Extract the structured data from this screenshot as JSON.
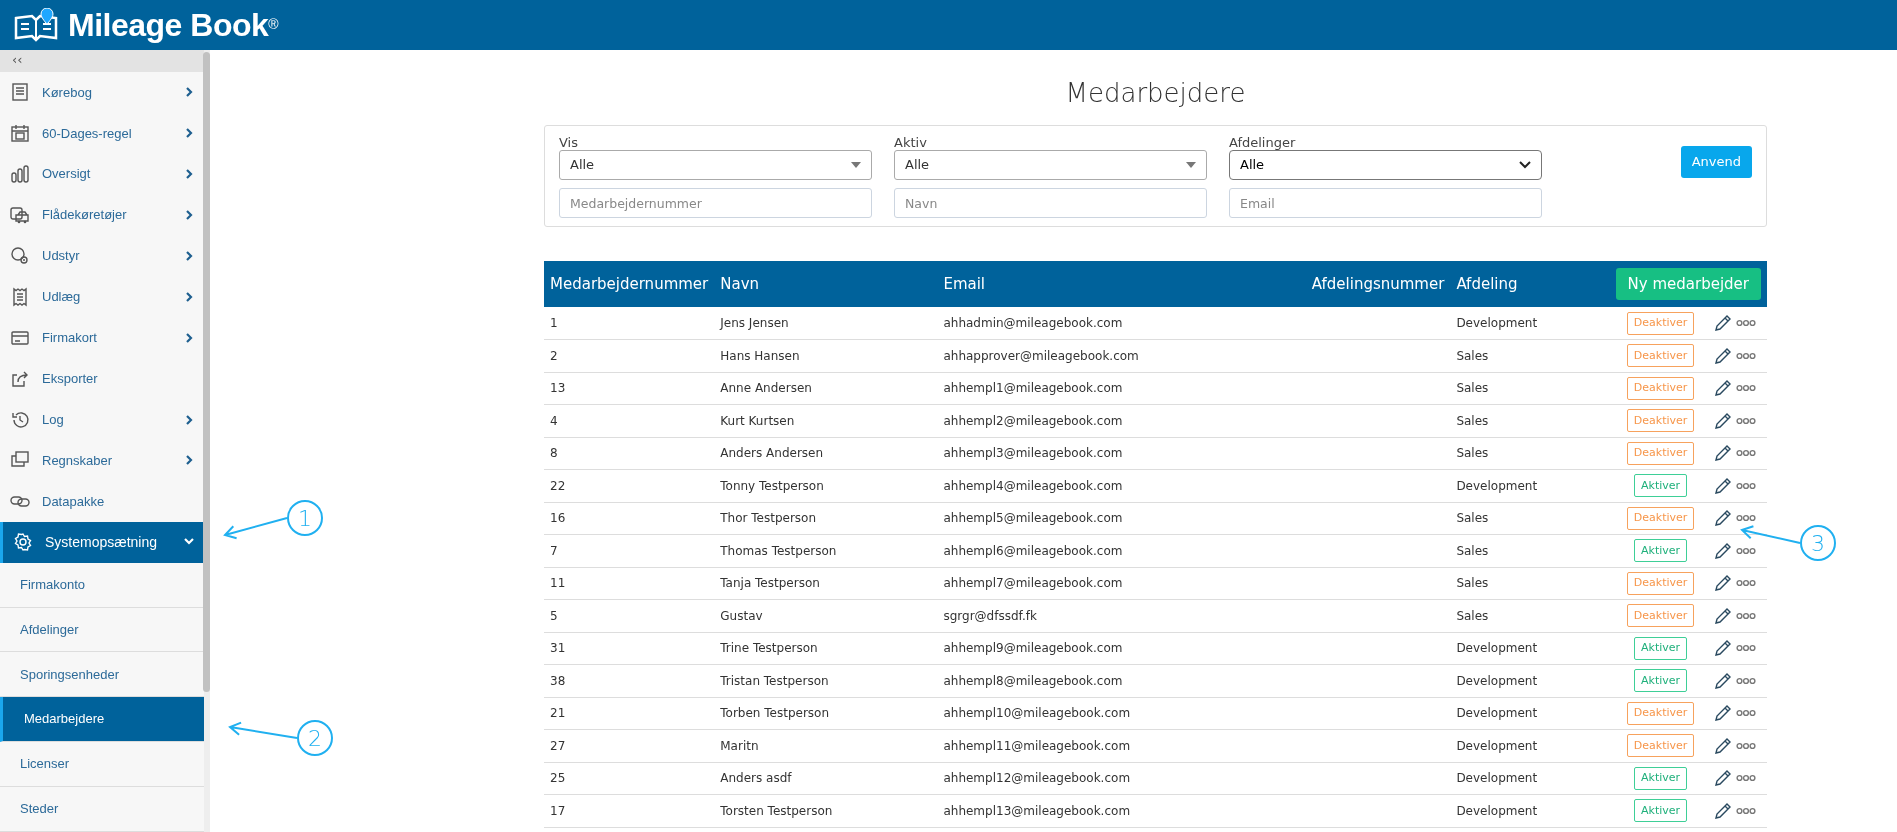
{
  "header": {
    "brand": "Mileage Book$^{®}$"
  },
  "sidebar": {
    "collapse": "‹‹",
    "items": [
      {
        "label": "Kørebog",
        "expandable": true,
        "expanded": false
      },
      {
        "label": "60-Dages-regel",
        "expandable": true,
        "expanded": false
      },
      {
        "label": "Oversigt",
        "expandable": true,
        "expanded": false
      },
      {
        "label": "Flådekøretøjer",
        "expandable": true,
        "expanded": false
      },
      {
        "label": "Udstyr",
        "expandable": true,
        "expanded": false
      },
      {
        "label": "Udlæg",
        "expandable": true,
        "expanded": false
      },
      {
        "label": "Firmakort",
        "expandable": true,
        "expanded": false
      },
      {
        "label": "Eksporter",
        "expandable": false,
        "expanded": false
      },
      {
        "label": "Log",
        "expandable": true,
        "expanded": false
      },
      {
        "label": "Regnskaber",
        "expandable": true,
        "expanded": false
      },
      {
        "label": "Datapakke",
        "expandable": false,
        "expanded": false
      },
      {
        "label": "Systemopsætning",
        "expandable": true,
        "expanded": true,
        "children": [
          {
            "label": "Firmakonto",
            "selected": false
          },
          {
            "label": "Afdelinger",
            "selected": false
          },
          {
            "label": "Sporingsenheder",
            "selected": false
          },
          {
            "label": "Medarbejdere",
            "selected": true
          },
          {
            "label": "Licenser",
            "selected": false
          },
          {
            "label": "Steder",
            "selected": false
          }
        ]
      }
    ]
  },
  "page": {
    "title": "Medarbejdere"
  },
  "filters": {
    "selects": [
      {
        "label": "Vis",
        "value": "Alle",
        "kind": "custom"
      },
      {
        "label": "Aktiv",
        "value": "Alle",
        "kind": "custom"
      },
      {
        "label": "Afdelinger",
        "value": "Alle",
        "kind": "native"
      }
    ],
    "inputs": [
      {
        "placeholder": "Medarbejdernummer"
      },
      {
        "placeholder": "Navn"
      },
      {
        "placeholder": "Email"
      }
    ],
    "apply": "Anvend"
  },
  "table": {
    "columns": [
      "Medarbejdernummer",
      "Navn",
      "Email",
      "Afdelingsnummer",
      "Afdeling"
    ],
    "new_button": "Ny medarbejder",
    "rows": [
      {
        "number": "1",
        "name": "Jens Jensen",
        "email": "ahhadmin@mileagebook.com",
        "department": "Development",
        "toggle": {
          "label": "Deaktiver",
          "kind": "deactivate"
        }
      },
      {
        "number": "2",
        "name": "Hans Hansen",
        "email": "ahhapprover@mileagebook.com",
        "department": "Sales",
        "toggle": {
          "label": "Deaktiver",
          "kind": "deactivate"
        }
      },
      {
        "number": "13",
        "name": "Anne Andersen",
        "email": "ahhempl1@mileagebook.com",
        "department": "Sales",
        "toggle": {
          "label": "Deaktiver",
          "kind": "deactivate"
        }
      },
      {
        "number": "4",
        "name": "Kurt Kurtsen",
        "email": "ahhempl2@mileagebook.com",
        "department": "Sales",
        "toggle": {
          "label": "Deaktiver",
          "kind": "deactivate"
        }
      },
      {
        "number": "8",
        "name": "Anders Andersen",
        "email": "ahhempl3@mileagebook.com",
        "department": "Sales",
        "toggle": {
          "label": "Deaktiver",
          "kind": "deactivate"
        }
      },
      {
        "number": "22",
        "name": "Tonny Testperson",
        "email": "ahhempl4@mileagebook.com",
        "department": "Development",
        "toggle": {
          "label": "Aktiver",
          "kind": "activate"
        }
      },
      {
        "number": "16",
        "name": "Thor Testperson",
        "email": "ahhempl5@mileagebook.com",
        "department": "Sales",
        "toggle": {
          "label": "Deaktiver",
          "kind": "deactivate"
        }
      },
      {
        "number": "7",
        "name": "Thomas Testperson",
        "email": "ahhempl6@mileagebook.com",
        "department": "Sales",
        "toggle": {
          "label": "Aktiver",
          "kind": "activate"
        }
      },
      {
        "number": "11",
        "name": "Tanja Testperson",
        "email": "ahhempl7@mileagebook.com",
        "department": "Sales",
        "toggle": {
          "label": "Deaktiver",
          "kind": "deactivate"
        }
      },
      {
        "number": "5",
        "name": "Gustav",
        "email": "sgrgr@dfssdf.fk",
        "department": "Sales",
        "toggle": {
          "label": "Deaktiver",
          "kind": "deactivate"
        }
      },
      {
        "number": "31",
        "name": "Trine Testperson",
        "email": "ahhempl9@mileagebook.com",
        "department": "Development",
        "toggle": {
          "label": "Aktiver",
          "kind": "activate"
        }
      },
      {
        "number": "38",
        "name": "Tristan Testperson",
        "email": "ahhempl8@mileagebook.com",
        "department": "Development",
        "toggle": {
          "label": "Aktiver",
          "kind": "activate"
        }
      },
      {
        "number": "21",
        "name": "Torben Testperson",
        "email": "ahhempl10@mileagebook.com",
        "department": "Development",
        "toggle": {
          "label": "Deaktiver",
          "kind": "deactivate"
        }
      },
      {
        "number": "27",
        "name": "Maritn",
        "email": "ahhempl11@mileagebook.com",
        "department": "Development",
        "toggle": {
          "label": "Deaktiver",
          "kind": "deactivate"
        }
      },
      {
        "number": "25",
        "name": "Anders asdf",
        "email": "ahhempl12@mileagebook.com",
        "department": "Development",
        "toggle": {
          "label": "Aktiver",
          "kind": "activate"
        }
      },
      {
        "number": "17",
        "name": "Torsten Testperson",
        "email": "ahhempl13@mileagebook.com",
        "department": "Development",
        "toggle": {
          "label": "Aktiver",
          "kind": "activate"
        }
      }
    ]
  },
  "callouts": [
    {
      "number": "1"
    },
    {
      "number": "2"
    },
    {
      "number": "3"
    }
  ]
}
